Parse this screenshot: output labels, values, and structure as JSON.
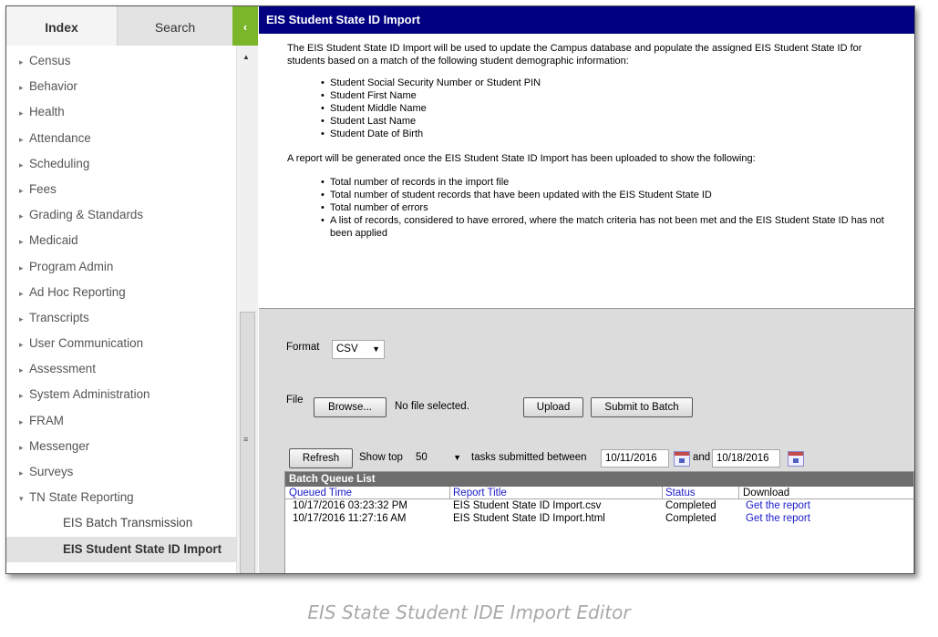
{
  "sidebar": {
    "tabs": {
      "index": "Index",
      "search": "Search",
      "collapse": "‹"
    },
    "items": [
      {
        "label": "Census"
      },
      {
        "label": "Behavior"
      },
      {
        "label": "Health"
      },
      {
        "label": "Attendance"
      },
      {
        "label": "Scheduling"
      },
      {
        "label": "Fees"
      },
      {
        "label": "Grading & Standards"
      },
      {
        "label": "Medicaid"
      },
      {
        "label": "Program Admin"
      },
      {
        "label": "Ad Hoc Reporting"
      },
      {
        "label": "Transcripts"
      },
      {
        "label": "User Communication"
      },
      {
        "label": "Assessment"
      },
      {
        "label": "System Administration"
      },
      {
        "label": "FRAM"
      },
      {
        "label": "Messenger"
      },
      {
        "label": "Surveys"
      },
      {
        "label": "TN State Reporting"
      }
    ],
    "subitems": [
      {
        "label": "EIS Batch Transmission"
      },
      {
        "label": "EIS Student State ID Import"
      }
    ],
    "arrow_collapsed": "▸",
    "arrow_expanded": "▾"
  },
  "main": {
    "title": "EIS Student State ID Import",
    "intro": "The EIS Student State ID Import will be used to update the Campus database and populate the assigned EIS Student State ID for students based on a match of the following student demographic information:",
    "match_fields": [
      "Student Social Security Number or Student PIN",
      "Student First Name",
      "Student Middle Name",
      "Student Last Name",
      "Student Date of Birth"
    ],
    "report_intro": "A report will be generated once the EIS Student State ID Import has been uploaded to show the following:",
    "report_items": [
      "Total number of records in the import file",
      "Total number of student records that have been updated with the EIS Student State ID",
      "Total number of errors",
      "A list of records, considered to have errored, where the match criteria has not been met and the EIS Student State ID has not been applied"
    ]
  },
  "controls": {
    "format_label": "Format",
    "format_value": "CSV",
    "file_label": "File",
    "browse_label": "Browse...",
    "no_file": "No file selected.",
    "upload_label": "Upload",
    "submit_label": "Submit to Batch",
    "refresh_label": "Refresh",
    "show_top_label": "Show top",
    "show_top_value": "50",
    "between_label": "tasks submitted between",
    "date_from": "10/11/2016",
    "and_label": "and",
    "date_to": "10/18/2016"
  },
  "batch_queue": {
    "title": "Batch Queue List",
    "columns": {
      "queued": "Queued Time",
      "report": "Report Title",
      "status": "Status",
      "download": "Download"
    },
    "rows": [
      {
        "queued": "10/17/2016 03:23:32 PM",
        "report": "EIS Student State ID Import.csv",
        "status": "Completed",
        "download": "Get the report"
      },
      {
        "queued": "10/17/2016 11:27:16 AM",
        "report": "EIS Student State ID Import.html",
        "status": "Completed",
        "download": "Get the report"
      }
    ]
  },
  "caption": "EIS State Student IDE Import Editor"
}
